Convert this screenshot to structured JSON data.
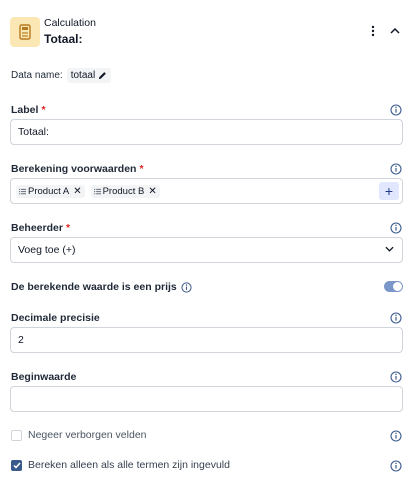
{
  "header": {
    "type_label": "Calculation",
    "title": "Totaal:",
    "icon": "calculator-icon"
  },
  "data_name": {
    "label": "Data name:",
    "value": "totaal"
  },
  "fields": {
    "label": {
      "label": "Label",
      "required_mark": "*",
      "value": "Totaal:"
    },
    "conditions": {
      "label": "Berekening voorwaarden",
      "required_mark": "*",
      "tags": [
        "Product A",
        "Product B"
      ],
      "add_label": "+"
    },
    "operator": {
      "label": "Beheerder",
      "required_mark": "*",
      "selected": "Voeg toe (+)"
    },
    "is_price": {
      "label": "De berekende waarde is een prijs",
      "on": true
    },
    "decimal_precision": {
      "label": "Decimale precisie",
      "value": "2"
    },
    "start_value": {
      "label": "Beginwaarde",
      "value": ""
    },
    "ignore_hidden": {
      "label": "Negeer verborgen velden",
      "checked": false
    },
    "only_if_all": {
      "label": "Bereken alleen als alle termen zijn ingevuld",
      "checked": true
    }
  },
  "colors": {
    "accent": "#3b5a8c",
    "required": "#dc2626",
    "icon_bg": "#fbe7b3",
    "toggle_on": "#7b96c9"
  }
}
